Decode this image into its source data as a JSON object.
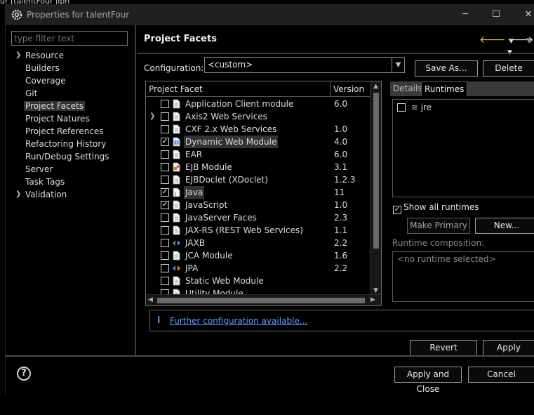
{
  "background_title": "ur [talentFour jlph",
  "dialog": {
    "title": "Properties for talentFour",
    "window_controls": {
      "minimize": "─",
      "maximize": "☐",
      "close": "✕"
    }
  },
  "sidebar": {
    "filter_placeholder": "type filter text",
    "items": [
      {
        "label": "Resource",
        "expandable": true
      },
      {
        "label": "Builders",
        "expandable": false
      },
      {
        "label": "Coverage",
        "expandable": false
      },
      {
        "label": "Git",
        "expandable": false
      },
      {
        "label": "Project Facets",
        "expandable": false,
        "selected": true
      },
      {
        "label": "Project Natures",
        "expandable": false
      },
      {
        "label": "Project References",
        "expandable": false
      },
      {
        "label": "Refactoring History",
        "expandable": false
      },
      {
        "label": "Run/Debug Settings",
        "expandable": false
      },
      {
        "label": "Server",
        "expandable": false
      },
      {
        "label": "Task Tags",
        "expandable": false
      },
      {
        "label": "Validation",
        "expandable": true
      }
    ]
  },
  "page": {
    "title": "Project Facets",
    "configuration_label": "Configuration:",
    "configuration_value": "<custom>",
    "save_as_label": "Save As...",
    "delete_label": "Delete",
    "table": {
      "col_facet": "Project Facet",
      "col_version": "Version",
      "rows": [
        {
          "name": "Application Client module",
          "version": "6.0",
          "checked": false,
          "icon": "file-icon",
          "expandable": false
        },
        {
          "name": "Axis2 Web Services",
          "version": "",
          "checked": false,
          "icon": "file-icon",
          "expandable": true
        },
        {
          "name": "CXF 2.x Web Services",
          "version": "1.0",
          "checked": false,
          "icon": "file-icon",
          "expandable": false
        },
        {
          "name": "Dynamic Web Module",
          "version": "4.0",
          "checked": true,
          "icon": "web-module-icon",
          "expandable": false,
          "highlighted": true
        },
        {
          "name": "EAR",
          "version": "6.0",
          "checked": false,
          "icon": "file-icon",
          "expandable": false
        },
        {
          "name": "EJB Module",
          "version": "3.1",
          "checked": false,
          "icon": "ejb-icon",
          "expandable": false
        },
        {
          "name": "EJBDoclet (XDoclet)",
          "version": "1.2.3",
          "checked": false,
          "icon": "file-icon",
          "expandable": false
        },
        {
          "name": "Java",
          "version": "11",
          "checked": true,
          "icon": "java-icon",
          "expandable": false,
          "highlighted": true
        },
        {
          "name": "JavaScript",
          "version": "1.0",
          "checked": true,
          "icon": "file-icon",
          "expandable": false
        },
        {
          "name": "JavaServer Faces",
          "version": "2.3",
          "checked": false,
          "icon": "file-icon",
          "expandable": false
        },
        {
          "name": "JAX-RS (REST Web Services)",
          "version": "1.1",
          "checked": false,
          "icon": "file-icon",
          "expandable": false
        },
        {
          "name": "JAXB",
          "version": "2.2",
          "checked": false,
          "icon": "jaxb-icon",
          "expandable": false
        },
        {
          "name": "JCA Module",
          "version": "1.6",
          "checked": false,
          "icon": "file-icon",
          "expandable": false
        },
        {
          "name": "JPA",
          "version": "2.2",
          "checked": false,
          "icon": "jpa-icon",
          "expandable": false
        },
        {
          "name": "Static Web Module",
          "version": "",
          "checked": false,
          "icon": "file-icon",
          "expandable": false
        },
        {
          "name": "Utility Module",
          "version": "",
          "checked": false,
          "icon": "file-icon",
          "expandable": false
        }
      ]
    },
    "details_tab": "Details",
    "runtimes_tab": "Runtimes",
    "runtimes": [
      {
        "name": "jre",
        "checked": false
      }
    ],
    "show_all_runtimes_label": "Show all runtimes",
    "show_all_runtimes_checked": true,
    "make_primary_label": "Make Primary",
    "new_label": "New...",
    "runtime_composition_label": "Runtime composition:",
    "runtime_composition_value": "<no runtime selected>",
    "info_link": "Further configuration available...",
    "revert_label": "Revert",
    "apply_label": "Apply"
  },
  "footer": {
    "apply_close_label": "Apply and Close",
    "cancel_label": "Cancel"
  }
}
